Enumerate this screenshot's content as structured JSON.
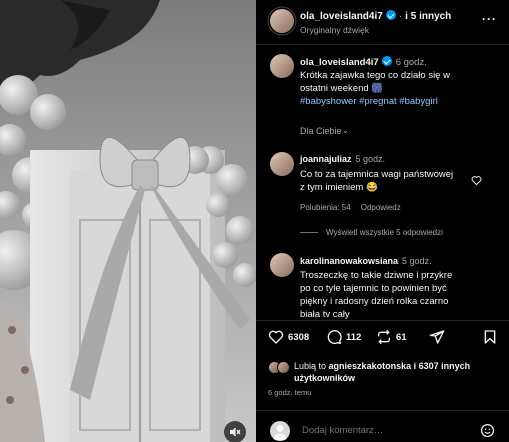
{
  "post": {
    "author": "ola_loveisland4i7",
    "verified": true,
    "and_others": "i 5 innych",
    "audio": "Oryginalny dźwięk",
    "caption_time": "6 godz.",
    "caption_text": "Krótka zajawka  tego co działo się w ostatni weekend 🎆",
    "hashtags": "#babyshower #pregnat #babygirl",
    "posted_ago": "6 godz. temu"
  },
  "comments_filter": "Dla Ciebie",
  "comments": [
    {
      "author": "joannajuliaz",
      "time": "5 godz.",
      "text": "Co to za tajemnica wagi państwowej z tym imieniem 😂",
      "likes": "Polubienia: 54",
      "reply": "Odpowiedz",
      "view_replies": "Wyświetl wszystkie 5 odpowiedzi"
    },
    {
      "author": "karolinanowakowsiana",
      "time": "5 godz.",
      "text": "Troszeczkę to takie dziwne i przykre po co tyle tajemnic to powinien być piękny i radosny dzień rolka czarno biała tv cały"
    }
  ],
  "actions": {
    "likes_count": "6308",
    "comments_count": "112",
    "reposts_count": "61"
  },
  "liked_by": {
    "prefix": "Lubią to",
    "user": "agnieszkakotonska",
    "suffix": "i 6307 innych użytkowników"
  },
  "add_comment": {
    "placeholder": "Dodaj komentarz…"
  },
  "colors": {
    "background": "#000000",
    "verified": "#0095f6",
    "secondary_text": "#a8a8a8",
    "hashtag": "#8fc7ff"
  }
}
